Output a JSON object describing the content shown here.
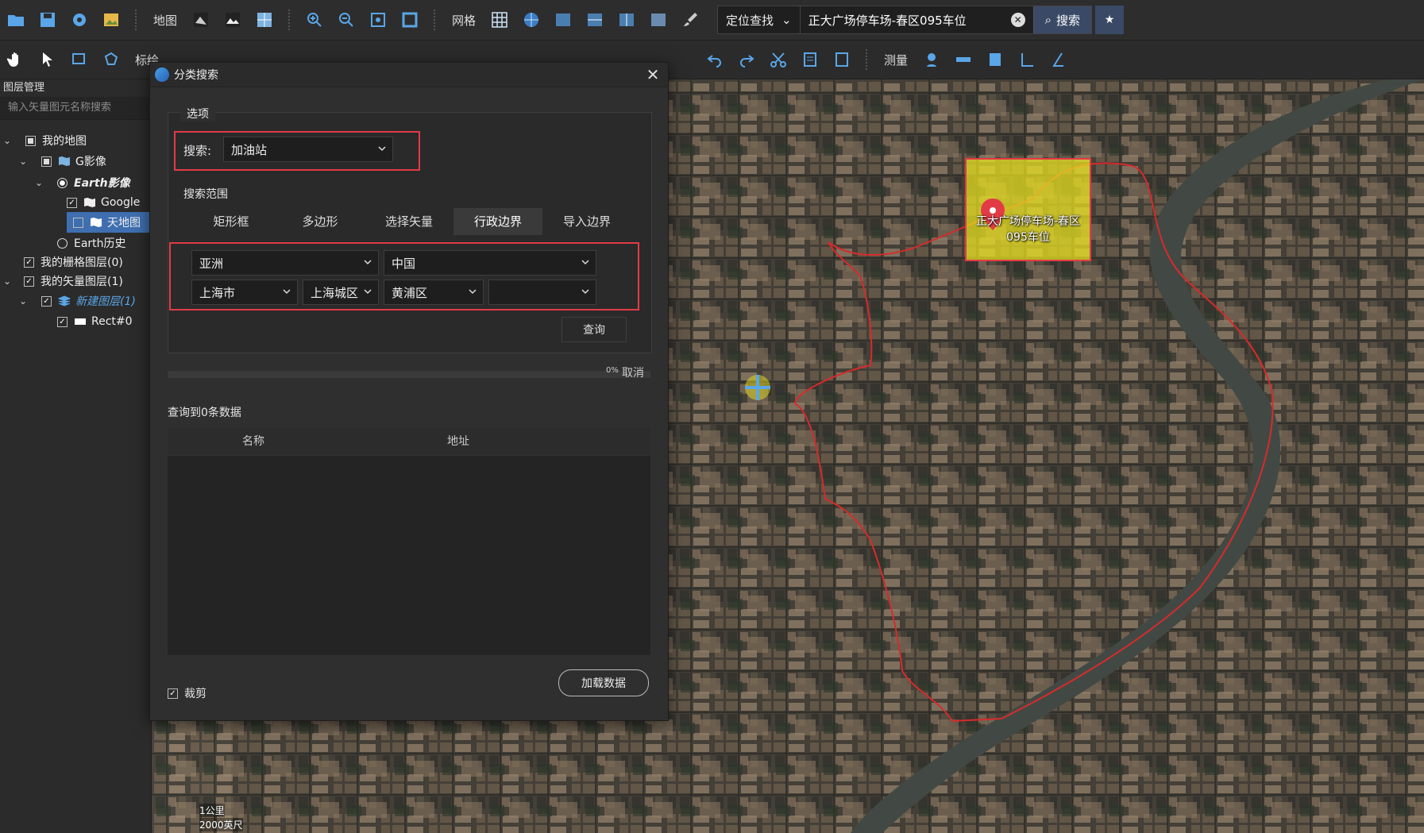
{
  "toolbar": {
    "map_label": "地图",
    "grid_label": "网格",
    "annotate_label": "标绘",
    "measure_label": "测量",
    "search_scope": "定位查找",
    "search_value": "正大广场停车场-春区095车位",
    "search_button": "搜索"
  },
  "layer_panel": {
    "title": "图层管理",
    "search_placeholder": "输入矢量图元名称搜索",
    "items": [
      {
        "label": "我的地图"
      },
      {
        "label": "G影像"
      },
      {
        "label": "Earth影像"
      },
      {
        "label": "Google"
      },
      {
        "label": "天地图"
      },
      {
        "label": "Earth历史"
      },
      {
        "label": "我的栅格图层(0)"
      },
      {
        "label": "我的矢量图层(1)"
      },
      {
        "label": "新建图层(1)"
      },
      {
        "label": "Rect#0"
      }
    ]
  },
  "dialog": {
    "title": "分类搜索",
    "options_legend": "选项",
    "search_label": "搜索:",
    "search_value": "加油站",
    "range_label": "搜索范围",
    "tabs": [
      "矩形框",
      "多边形",
      "选择矢量",
      "行政边界",
      "导入边界"
    ],
    "active_tab": "行政边界",
    "region": {
      "continent": "亚洲",
      "country": "中国",
      "city": "上海市",
      "district_group": "上海城区",
      "district": "黄浦区",
      "sub": ""
    },
    "query_button": "查询",
    "progress_text": "0%",
    "cancel_button": "取消",
    "result_count": "查询到0条数据",
    "columns": [
      "名称",
      "地址"
    ],
    "crop_label": "裁剪",
    "load_button": "加载数据"
  },
  "map": {
    "marker_label": "正大广场停车场-春区095车位",
    "scale_km": "1公里",
    "scale_ft": "2000英尺"
  },
  "colors": {
    "highlight_red": "#e23b46",
    "selection_yellow": "#e8e020",
    "accent_blue": "#3f6fb0"
  }
}
